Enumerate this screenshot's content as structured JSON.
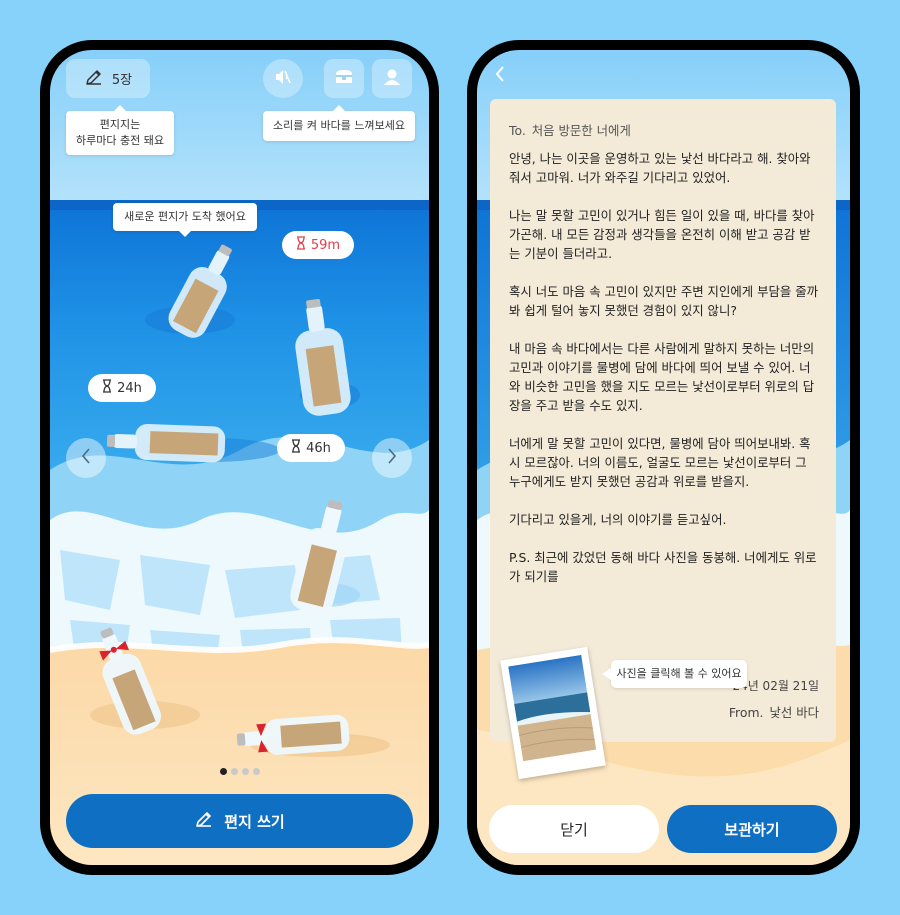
{
  "left_screen": {
    "letter_count": "5장",
    "tooltip_refill": [
      "편지지는",
      "하루마다 충전 돼요"
    ],
    "tooltip_sound": "소리를 켜 바다를 느껴보세요",
    "tooltip_new_letter": "새로운 편지가 도착 했어요",
    "timers": [
      "59m",
      "24h",
      "46h"
    ],
    "pagination": {
      "total": 4,
      "active": 1
    },
    "write_button": "편지 쓰기"
  },
  "right_screen": {
    "letter": {
      "to_label": "To.",
      "to_name": "처음 방문한 너에게",
      "paragraphs": [
        "안녕, 나는 이곳을 운영하고 있는 낯선 바다라고 해. 찾아와줘서 고마워. 너가 와주길 기다리고 있었어.",
        "나는 말 못할 고민이 있거나 힘든 일이 있을 때, 바다를 찾아가곤해. 내 모든 감정과 생각들을 온전히 이해 받고 공감 받는 기분이 들더라고.",
        "혹시 너도 마음 속 고민이 있지만 주변 지인에게 부담을 줄까 봐 쉽게 털어 놓지 못했던 경험이 있지 않니?",
        "내 마음 속 바다에서는 다른 사람에게 말하지 못하는 너만의 고민과 이야기를 물병에 담에 바다에 띄어 보낼 수 있어. 너와 비슷한 고민을 했을 지도 모르는 낯선이로부터 위로의 답장을 주고 받을 수도 있지.",
        "너에게 말 못할 고민이 있다면, 물병에 담아 띄어보내봐. 혹시 모르잖아. 너의 이름도, 얼굴도 모르는 낯선이로부터 그 누구에게도 받지 못했던 공감과 위로를 받을지.",
        "기다리고 있을게, 너의 이야기를 듣고싶어.",
        "P.S. 최근에 갔었던 동해 바다 사진을 동봉해. 너에게도 위로가 되기를"
      ],
      "date": "24년 02월 21일",
      "from_label": "From.",
      "from_name": "낯선 바다"
    },
    "photo_tooltip": "사진을 클릭해 볼 수 있어요",
    "close_button": "닫기",
    "save_button": "보관하기"
  }
}
